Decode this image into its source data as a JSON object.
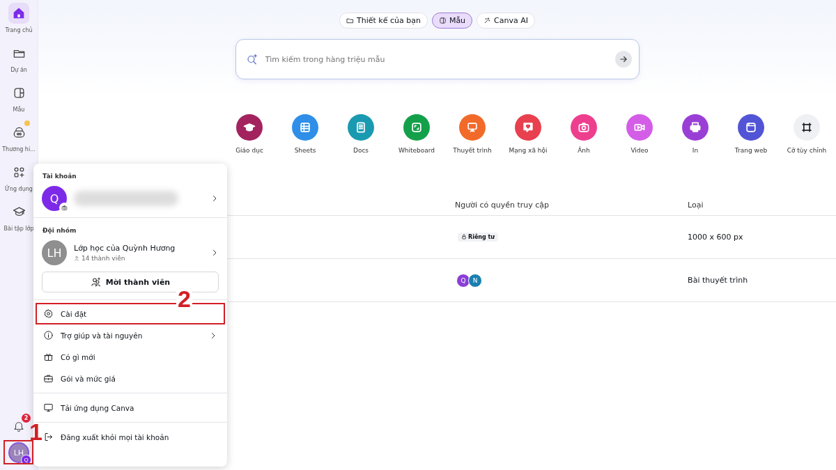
{
  "sidebar": {
    "items": [
      {
        "label": "Trang chủ",
        "selected": true,
        "premium": false
      },
      {
        "label": "Dự án",
        "selected": false,
        "premium": false
      },
      {
        "label": "Mẫu",
        "selected": false,
        "premium": false
      },
      {
        "label": "Thương hi...",
        "selected": false,
        "premium": true
      },
      {
        "label": "Ứng dụng",
        "selected": false,
        "premium": false
      },
      {
        "label": "Bài tập lớp",
        "selected": false,
        "premium": false
      }
    ],
    "notifications": {
      "count": "2"
    },
    "profile": {
      "initials": "LH",
      "badge": "Q",
      "highlighted": true
    }
  },
  "tabs": [
    {
      "label": "Thiết kế của bạn",
      "selected": false
    },
    {
      "label": "Mẫu",
      "selected": true
    },
    {
      "label": "Canva AI",
      "selected": false
    }
  ],
  "search": {
    "placeholder": "Tìm kiếm trong hàng triệu mẫu"
  },
  "categories": [
    {
      "label": "Giáo dục",
      "color": "#a3235f"
    },
    {
      "label": "Sheets",
      "color": "#2f8fe8"
    },
    {
      "label": "Docs",
      "color": "#1a9ab0"
    },
    {
      "label": "Whiteboard",
      "color": "#14a04a"
    },
    {
      "label": "Thuyết trình",
      "color": "#f26a2a"
    },
    {
      "label": "Mạng xã hội",
      "color": "#e8404f"
    },
    {
      "label": "Ảnh",
      "color": "#ee3f8f"
    },
    {
      "label": "Video",
      "color": "#d45de8"
    },
    {
      "label": "In",
      "color": "#9a3fd6"
    },
    {
      "label": "Trang web",
      "color": "#5254d6"
    },
    {
      "label": "Cỡ tùy chỉnh",
      "color": "#eef0f3"
    }
  ],
  "table": {
    "columns": [
      "Người có quyền truy cập",
      "Loại"
    ],
    "rows": [
      {
        "access": {
          "kind": "badge",
          "label": "Riêng tư"
        },
        "type": "1000 x 600 px"
      },
      {
        "access": {
          "kind": "avatars",
          "avatars": [
            {
              "initial": "Q",
              "color": "#8a3fd6"
            },
            {
              "initial": "N",
              "color": "#1a7fb0"
            }
          ]
        },
        "type": "Bài thuyết trình"
      }
    ]
  },
  "menu": {
    "account": {
      "heading": "Tài khoản",
      "initial": "Q"
    },
    "team": {
      "heading": "Đội nhóm",
      "initials": "LH",
      "name": "Lớp học của Quỳnh Hương",
      "members": "14 thành viên",
      "invite": "Mời thành viên"
    },
    "item_groups": [
      [
        {
          "label": "Cài đặt",
          "highlighted": true,
          "submenu": false
        },
        {
          "label": "Trợ giúp và tài nguyên",
          "highlighted": false,
          "submenu": true
        },
        {
          "label": "Có gì mới",
          "highlighted": false,
          "submenu": false
        },
        {
          "label": "Gói và mức giá",
          "highlighted": false,
          "submenu": false
        }
      ],
      [
        {
          "label": "Tải ứng dụng Canva",
          "highlighted": false,
          "submenu": false
        }
      ],
      [
        {
          "label": "Đăng xuất khỏi mọi tài khoản",
          "highlighted": false,
          "submenu": false
        }
      ]
    ]
  },
  "annotations": [
    {
      "label": "1"
    },
    {
      "label": "2"
    }
  ]
}
